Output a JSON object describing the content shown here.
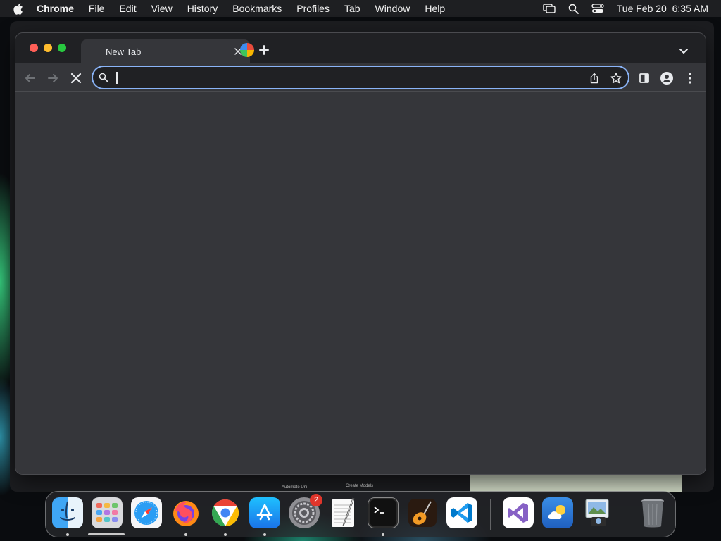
{
  "menubar": {
    "app_name": "Chrome",
    "items": [
      "File",
      "Edit",
      "View",
      "History",
      "Bookmarks",
      "Profiles",
      "Tab",
      "Window",
      "Help"
    ],
    "datetime": "Tue Feb 20  6:35 AM",
    "status_icons": [
      "screen-mirroring-icon",
      "spotlight-search-icon",
      "control-center-icon"
    ]
  },
  "browser": {
    "tab": {
      "title": "New Tab"
    },
    "omnibox": {
      "value": "",
      "placeholder": ""
    },
    "status": "loading",
    "accent_color": "#8ab4f8"
  },
  "background_peek": {
    "labels": [
      "Automate Uni",
      "Create Models"
    ]
  },
  "dock": {
    "apps": [
      {
        "name": "Finder",
        "icon": "finder-icon",
        "running": true
      },
      {
        "name": "Launchpad",
        "icon": "launchpad-icon",
        "running": false
      },
      {
        "name": "Safari",
        "icon": "safari-icon",
        "running": false
      },
      {
        "name": "Firefox",
        "icon": "firefox-icon",
        "running": true
      },
      {
        "name": "Google Chrome",
        "icon": "chrome-icon",
        "running": true
      },
      {
        "name": "App Store",
        "icon": "app-store-icon",
        "running": true
      },
      {
        "name": "System Settings",
        "icon": "system-settings-icon",
        "running": false,
        "badge": "2"
      },
      {
        "name": "TextEdit",
        "icon": "textedit-icon",
        "running": false
      },
      {
        "name": "Terminal",
        "icon": "terminal-icon",
        "running": true
      },
      {
        "name": "GarageBand",
        "icon": "garageband-icon",
        "running": false
      },
      {
        "name": "Visual Studio Code",
        "icon": "vscode-icon",
        "running": false
      },
      {
        "name": "Visual Studio",
        "icon": "visual-studio-icon",
        "running": false
      },
      {
        "name": "Weather",
        "icon": "weather-icon",
        "running": false
      },
      {
        "name": "Preview",
        "icon": "preview-icon",
        "running": false
      },
      {
        "name": "Trash",
        "icon": "trash-icon",
        "running": false
      }
    ]
  }
}
